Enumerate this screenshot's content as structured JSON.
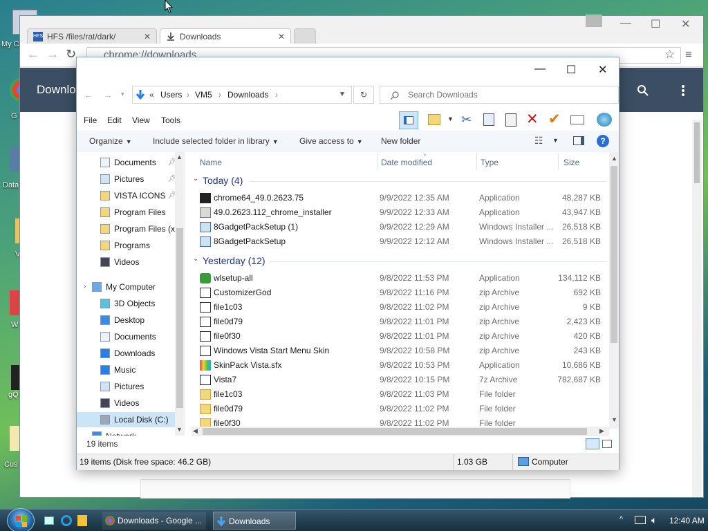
{
  "desktop": {
    "icons": [
      {
        "label": "My C"
      },
      {
        "label": "G\nCh"
      },
      {
        "label": "Data"
      },
      {
        "label": "V"
      },
      {
        "label": "W\nTw"
      },
      {
        "label": "gQ"
      },
      {
        "label": "Cus"
      }
    ]
  },
  "chrome": {
    "tabs": [
      {
        "label": "HFS /files/rat/dark/",
        "close": "✕"
      },
      {
        "label": "Downloads",
        "close": "✕"
      }
    ],
    "omnibox": "chrome://downloads",
    "page_title": "Downloa"
  },
  "explorer": {
    "breadcrumb": [
      "Users",
      "VM5",
      "Downloads"
    ],
    "breadcrumb_prefix": "«",
    "search_placeholder": "Search Downloads",
    "menu": [
      "File",
      "Edit",
      "View",
      "Tools"
    ],
    "commands": [
      {
        "label": "Organize"
      },
      {
        "label": "Include selected folder in library"
      },
      {
        "label": "Give access to"
      },
      {
        "label": "New folder"
      }
    ],
    "columns": {
      "name": "Name",
      "date": "Date modified",
      "type": "Type",
      "size": "Size"
    },
    "nav": [
      {
        "label": "Documents",
        "icon": "document-icon",
        "pin": true
      },
      {
        "label": "Pictures",
        "icon": "picture-icon",
        "pin": true
      },
      {
        "label": "VISTA ICONS",
        "icon": "folder-icon",
        "pin": true
      },
      {
        "label": "Program Files",
        "icon": "folder-icon"
      },
      {
        "label": "Program Files (x",
        "icon": "folder-icon"
      },
      {
        "label": "Programs",
        "icon": "folder-icon"
      },
      {
        "label": "Videos",
        "icon": "video-icon"
      },
      {
        "label": "My Computer",
        "icon": "computer-icon"
      },
      {
        "label": "3D Objects",
        "icon": "cube-icon"
      },
      {
        "label": "Desktop",
        "icon": "desktop-icon"
      },
      {
        "label": "Documents",
        "icon": "document-icon"
      },
      {
        "label": "Downloads",
        "icon": "download-icon"
      },
      {
        "label": "Music",
        "icon": "music-icon"
      },
      {
        "label": "Pictures",
        "icon": "picture-icon"
      },
      {
        "label": "Videos",
        "icon": "video-icon"
      },
      {
        "label": "Local Disk (C:)",
        "icon": "drive-icon",
        "selected": true
      },
      {
        "label": "Network",
        "icon": "network-icon"
      }
    ],
    "groups": [
      {
        "title": "Today (4)",
        "files": [
          {
            "name": "chrome64_49.0.2623.75",
            "date": "9/9/2022 12:35 AM",
            "type": "Application",
            "size": "48,287 KB",
            "icon": "7z-app-icon"
          },
          {
            "name": "49.0.2623.112_chrome_installer",
            "date": "9/9/2022 12:33 AM",
            "type": "Application",
            "size": "43,947 KB",
            "icon": "installer-icon"
          },
          {
            "name": "8GadgetPackSetup (1)",
            "date": "9/9/2022 12:29 AM",
            "type": "Windows Installer ...",
            "size": "26,518 KB",
            "icon": "msi-icon"
          },
          {
            "name": "8GadgetPackSetup",
            "date": "9/9/2022 12:12 AM",
            "type": "Windows Installer ...",
            "size": "26,518 KB",
            "icon": "msi-icon"
          }
        ]
      },
      {
        "title": "Yesterday (12)",
        "files": [
          {
            "name": "wlsetup-all",
            "date": "9/8/2022 11:53 PM",
            "type": "Application",
            "size": "134,112 KB",
            "icon": "app-icon"
          },
          {
            "name": "CustomizerGod",
            "date": "9/8/2022 11:16 PM",
            "type": "zip Archive",
            "size": "692 KB",
            "icon": "zip-icon"
          },
          {
            "name": "file1c03",
            "date": "9/8/2022 11:02 PM",
            "type": "zip Archive",
            "size": "9 KB",
            "icon": "zip-icon"
          },
          {
            "name": "file0d79",
            "date": "9/8/2022 11:01 PM",
            "type": "zip Archive",
            "size": "2,423 KB",
            "icon": "zip-icon"
          },
          {
            "name": "file0f30",
            "date": "9/8/2022 11:01 PM",
            "type": "zip Archive",
            "size": "420 KB",
            "icon": "zip-icon"
          },
          {
            "name": "Windows Vista Start Menu Skin",
            "date": "9/8/2022 10:58 PM",
            "type": "zip Archive",
            "size": "243 KB",
            "icon": "zip-icon"
          },
          {
            "name": "SkinPack Vista.sfx",
            "date": "9/8/2022 10:53 PM",
            "type": "Application",
            "size": "10,686 KB",
            "icon": "skinpack-icon"
          },
          {
            "name": "Vista7",
            "date": "9/8/2022 10:15 PM",
            "type": "7z Archive",
            "size": "782,687 KB",
            "icon": "7z-icon"
          },
          {
            "name": "file1c03",
            "date": "9/8/2022 11:03 PM",
            "type": "File folder",
            "size": "",
            "icon": "folder-icon"
          },
          {
            "name": "file0d79",
            "date": "9/8/2022 11:02 PM",
            "type": "File folder",
            "size": "",
            "icon": "folder-icon"
          },
          {
            "name": "file0f30",
            "date": "9/8/2022 11:02 PM",
            "type": "File folder",
            "size": "",
            "icon": "folder-icon"
          }
        ]
      }
    ],
    "status": "19 items",
    "details": {
      "disk": "19 items (Disk free space: 46.2 GB)",
      "size": "1.03 GB",
      "location": "Computer"
    }
  },
  "taskbar": {
    "items": [
      {
        "label": "Downloads - Google ...",
        "icon": "chrome-icon"
      },
      {
        "label": "Downloads",
        "icon": "download-icon"
      }
    ],
    "clock": "12:40 AM"
  },
  "colors": {
    "chrome_header": "#3b4e63",
    "group_header": "#1e3287",
    "selection": "#cce4f7",
    "taskbar": "#172e3d"
  }
}
